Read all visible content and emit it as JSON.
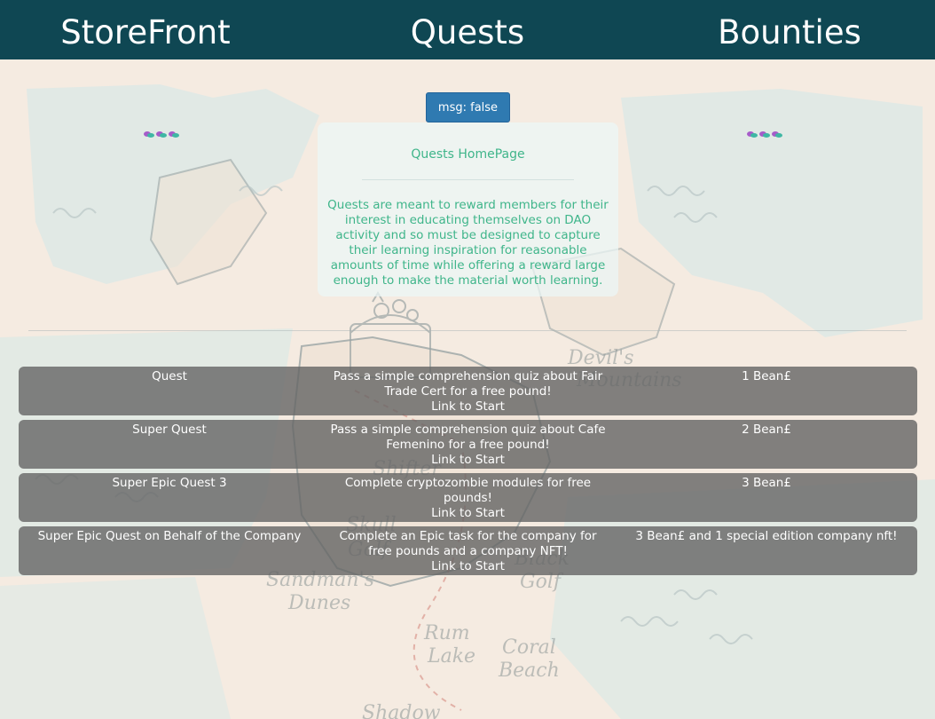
{
  "nav": {
    "storefront": "StoreFront",
    "quests": "Quests",
    "bounties": "Bounties"
  },
  "msg_button": "msg: false",
  "card": {
    "title": "Quests HomePage",
    "body": "Quests are meant to reward members for their interest in educating themselves on DAO activity and so must be designed to capture their learning inspiration for reasonable amounts of time while offering a reward large enough to make the material worth learning."
  },
  "quests": [
    {
      "name": "Quest",
      "description": "Pass a simple comprehension quiz about Fair Trade Cert for a free pound!",
      "link": "Link to Start",
      "reward": "1 Bean£"
    },
    {
      "name": "Super Quest",
      "description": "Pass a simple comprehension quiz about Cafe Femenino for a free pound!",
      "link": "Link to Start",
      "reward": "2 Bean£"
    },
    {
      "name": "Super Epic Quest 3",
      "description": "Complete cryptozombie modules for free pounds!",
      "link": "Link to Start",
      "reward": "3 Bean£"
    },
    {
      "name": "Super Epic Quest on Behalf of the Company",
      "description": "Complete an Epic task for the company for free pounds and a company NFT!",
      "link": "Link to Start",
      "reward": "3 Bean£ and 1 special edition company nft!"
    }
  ],
  "background": {
    "map_labels": [
      "Devil's Mountains",
      "Shifter Rives",
      "Skull Golf",
      "Black Golf",
      "Sandman's Dunes",
      "Rum Lake",
      "Coral Beach",
      "Shadow"
    ]
  },
  "colors": {
    "nav_bg": "#0f4753",
    "button_bg": "#2f7ab1",
    "card_text": "#3fb58a",
    "row_bg": "#646464"
  }
}
